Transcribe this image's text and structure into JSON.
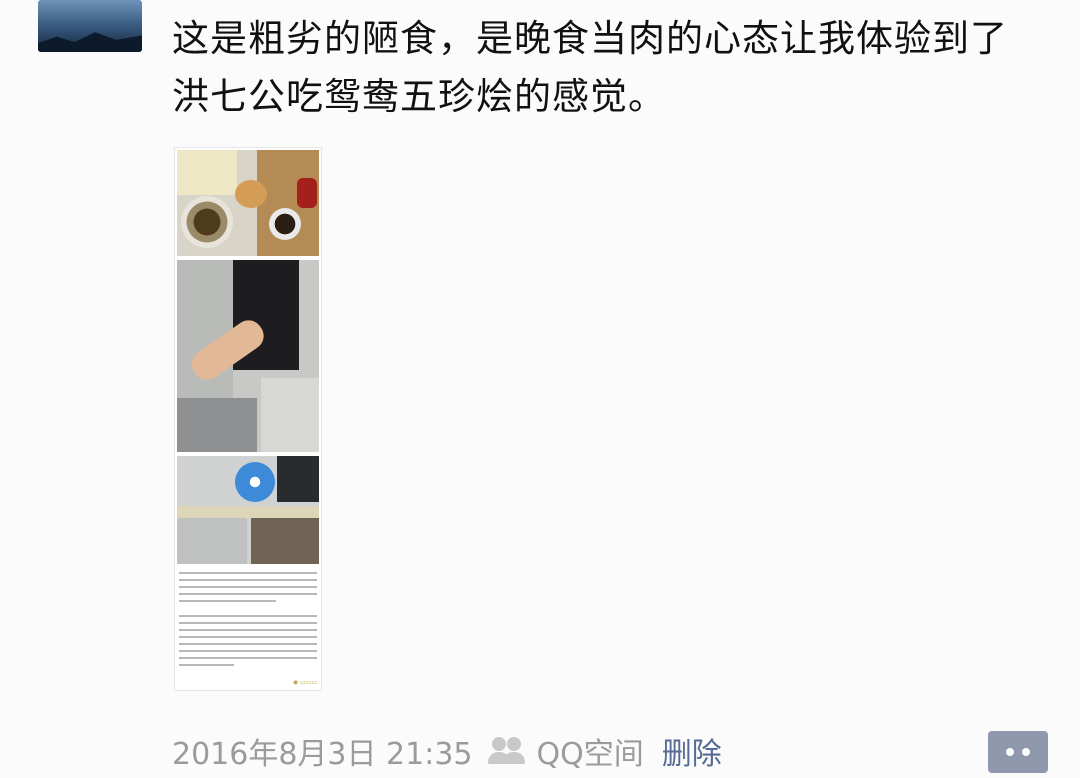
{
  "post": {
    "text_line1": "这是粗劣的陋食，是晚食当肉的心态让我体验到了",
    "text_line2": "洪七公吃鸳鸯五珍烩的感觉。"
  },
  "footer": {
    "timestamp": "2016年8月3日 21:35",
    "visibility_icon": "people-icon",
    "source": "QQ空间",
    "delete_label": "删除"
  },
  "comment_button": {
    "icon": "dots-icon"
  },
  "colors": {
    "link": "#576b95",
    "meta_text": "#9b9b9b",
    "comment_button": "#8e97ab"
  }
}
